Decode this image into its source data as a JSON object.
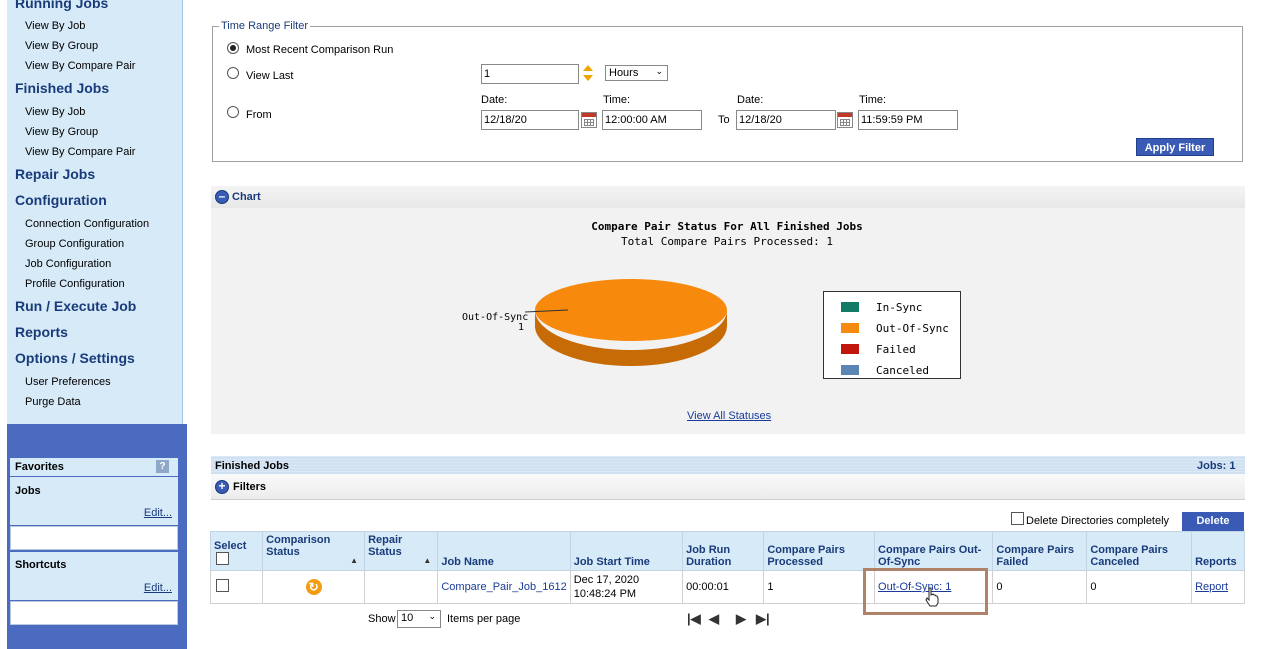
{
  "sidebar": {
    "running_jobs": "Running Jobs",
    "running_items": [
      "View By Job",
      "View By Group",
      "View By Compare Pair"
    ],
    "finished_jobs": "Finished Jobs",
    "finished_items": [
      "View By Job",
      "View By Group",
      "View By Compare Pair"
    ],
    "repair_jobs": "Repair Jobs",
    "configuration": "Configuration",
    "config_items": [
      "Connection Configuration",
      "Group Configuration",
      "Job Configuration",
      "Profile Configuration"
    ],
    "run_execute": "Run / Execute Job",
    "reports": "Reports",
    "options": "Options / Settings",
    "options_items": [
      "User Preferences",
      "Purge Data"
    ]
  },
  "favorites": {
    "title": "Favorites",
    "help": "?",
    "jobs_label": "Jobs",
    "jobs_edit": "Edit...",
    "shortcuts_label": "Shortcuts",
    "shortcuts_edit": "Edit..."
  },
  "filter": {
    "legend": "Time Range Filter",
    "most_recent": "Most Recent Comparison Run",
    "view_last": "View Last",
    "view_last_value": "1",
    "unit": "Hours",
    "from": "From",
    "date_label": "Date:",
    "time_label": "Time:",
    "from_date": "12/18/20",
    "from_time": "12:00:00 AM",
    "to": "To",
    "to_date": "12/18/20",
    "to_time": "11:59:59 PM",
    "apply": "Apply Filter"
  },
  "chart_section": {
    "header": "Chart",
    "view_all": "View All Statuses"
  },
  "chart_data": {
    "type": "pie",
    "title": "Compare Pair Status For All Finished Jobs",
    "subtitle": "Total Compare Pairs Processed: 1",
    "categories": [
      "In-Sync",
      "Out-Of-Sync",
      "Failed",
      "Canceled"
    ],
    "values": [
      0,
      1,
      0,
      0
    ],
    "colors": [
      "#137a63",
      "#f7890c",
      "#c0160c",
      "#5b86b3"
    ],
    "slice_label": "Out-Of-Sync",
    "slice_value": "1",
    "legend_position": "right"
  },
  "jobs": {
    "header": "Finished Jobs",
    "count": "Jobs: 1",
    "filters": "Filters",
    "delete_dirs": "Delete Directories completely",
    "delete": "Delete",
    "columns": [
      "Select",
      "Comparison Status",
      "Repair Status",
      "Job Name",
      "Job Start Time",
      "Job Run Duration",
      "Compare Pairs Processed",
      "Compare Pairs Out-Of-Sync",
      "Compare Pairs Failed",
      "Compare Pairs Canceled",
      "Reports"
    ],
    "row": {
      "job_name": "Compare_Pair_Job_1612",
      "start_line1": "Dec 17, 2020",
      "start_line2": "10:48:24 PM",
      "duration": "00:00:01",
      "processed": "1",
      "out_of_sync": "Out-Of-Sync: 1",
      "failed": "0",
      "canceled": "0",
      "report": "Report"
    },
    "show": "Show",
    "page_size": "10",
    "items_per_page": "Items per page"
  }
}
